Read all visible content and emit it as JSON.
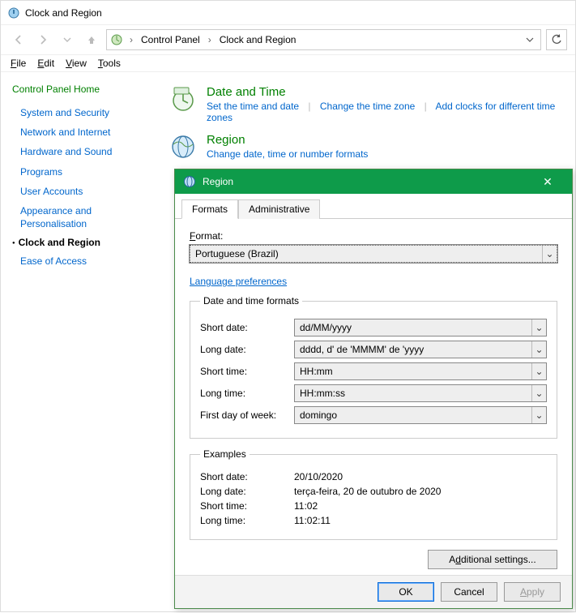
{
  "window": {
    "title": "Clock and Region"
  },
  "breadcrumb": {
    "root": "Control Panel",
    "current": "Clock and Region"
  },
  "menubar": {
    "file": "File",
    "file_ul": "F",
    "edit": "Edit",
    "edit_ul": "E",
    "view": "View",
    "view_ul": "V",
    "tools": "Tools",
    "tools_ul": "T"
  },
  "sidebar": {
    "home": "Control Panel Home",
    "items": [
      "System and Security",
      "Network and Internet",
      "Hardware and Sound",
      "Programs",
      "User Accounts",
      "Appearance and Personalisation"
    ],
    "current": "Clock and Region",
    "after": [
      "Ease of Access"
    ]
  },
  "applets": {
    "datetime": {
      "title": "Date and Time",
      "links": [
        "Set the time and date",
        "Change the time zone",
        "Add clocks for different time zones"
      ]
    },
    "region": {
      "title": "Region",
      "links": [
        "Change date, time or number formats"
      ]
    }
  },
  "dialog": {
    "title": "Region",
    "tabs": {
      "formats": "Formats",
      "admin": "Administrative"
    },
    "format_label": "Format:",
    "format_ul": "F",
    "format_value": "Portuguese (Brazil)",
    "lang_pref": "Language preferences",
    "group_formats": "Date and time formats",
    "rows": {
      "short_date": {
        "label": "Short date:",
        "ul": "S",
        "value": "dd/MM/yyyy"
      },
      "long_date": {
        "label": "Long date:",
        "ul": "L",
        "value": "dddd, d' de 'MMMM' de 'yyyy"
      },
      "short_time": {
        "label": "Short time:",
        "ul": "h",
        "value": "HH:mm"
      },
      "long_time": {
        "label": "Long time:",
        "ul": "o",
        "value": "HH:mm:ss"
      },
      "first_day": {
        "label": "First day of week:",
        "ul": "w",
        "value": "domingo"
      }
    },
    "group_examples": "Examples",
    "examples": {
      "short_date": {
        "label": "Short date:",
        "value": "20/10/2020"
      },
      "long_date": {
        "label": "Long date:",
        "value": "terça-feira, 20 de outubro de 2020"
      },
      "short_time": {
        "label": "Short time:",
        "value": "11:02"
      },
      "long_time": {
        "label": "Long time:",
        "value": "11:02:11"
      }
    },
    "additional": "Additional settings...",
    "additional_ul": "d",
    "buttons": {
      "ok": "OK",
      "cancel": "Cancel",
      "apply": "Apply"
    }
  }
}
